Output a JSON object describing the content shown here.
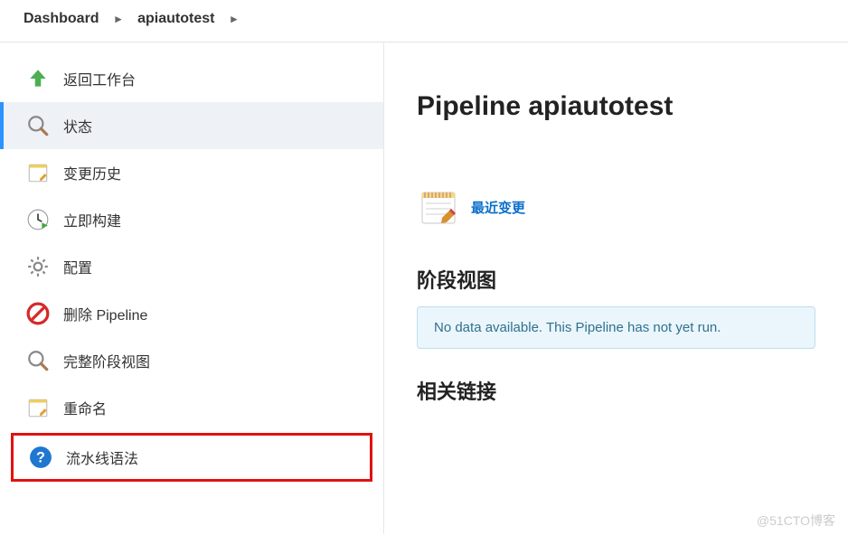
{
  "breadcrumb": {
    "items": [
      "Dashboard",
      "apiautotest"
    ]
  },
  "sidebar": {
    "items": [
      {
        "id": "back",
        "label": "返回工作台"
      },
      {
        "id": "status",
        "label": "状态"
      },
      {
        "id": "changes",
        "label": "变更历史"
      },
      {
        "id": "build",
        "label": "立即构建"
      },
      {
        "id": "configure",
        "label": "配置"
      },
      {
        "id": "delete",
        "label": "删除 Pipeline"
      },
      {
        "id": "stageview",
        "label": "完整阶段视图"
      },
      {
        "id": "rename",
        "label": "重命名"
      },
      {
        "id": "syntax",
        "label": "流水线语法"
      }
    ],
    "activeIndex": 1,
    "highlightIndex": 8
  },
  "content": {
    "title": "Pipeline apiautotest",
    "recentChanges": "最近变更",
    "stageView": {
      "heading": "阶段视图",
      "emptyMessage": "No data available. This Pipeline has not yet run."
    },
    "relatedLinksHeading": "相关链接"
  },
  "watermark": "@51CTO博客"
}
